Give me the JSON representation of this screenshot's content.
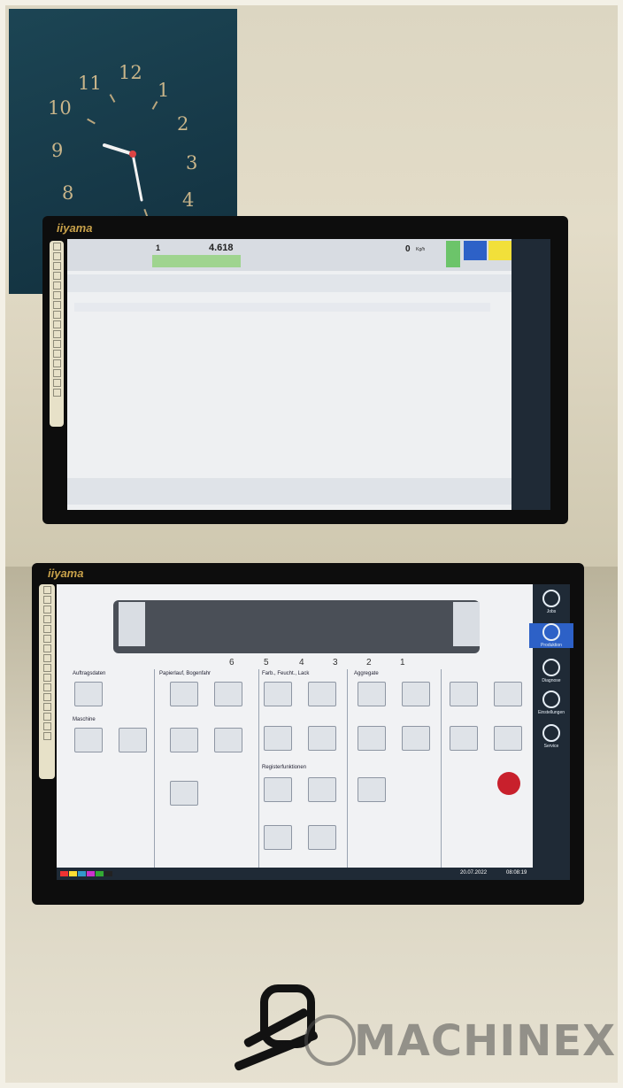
{
  "clock": {
    "numerals": [
      "12",
      "1",
      "2",
      "3",
      "4",
      "11",
      "10",
      "9",
      "8"
    ]
  },
  "top_monitor": {
    "brand": "iiyama",
    "header": {
      "counter_label": "1",
      "counter_value": "4.618",
      "speed_value": "0",
      "speed_unit": "Kg/h"
    }
  },
  "bottom_monitor": {
    "brand": "iiyama",
    "units_numbers": [
      "6",
      "5",
      "4",
      "3",
      "2",
      "1"
    ],
    "sections": {
      "a": "Auftragsdaten",
      "b": "Maschine",
      "c": "Papierlauf, Bogenfahr",
      "d": "Farb., Feucht., Lack",
      "e": "Registerfunktionen",
      "f": "Aggregate"
    },
    "rail": [
      "Jobs",
      "Produktion",
      "Diagnose",
      "Einstellungen",
      "Service"
    ],
    "status": {
      "date": "20.07.2022",
      "time": "08:08:19"
    }
  },
  "watermark": {
    "text": "MACHINEX"
  },
  "colors": {
    "rail": "#1f2a36",
    "accent_red": "#c8202c",
    "accent_blue": "#2d61c7",
    "accent_yellow": "#f2e03a",
    "accent_green": "#6cc46a"
  }
}
